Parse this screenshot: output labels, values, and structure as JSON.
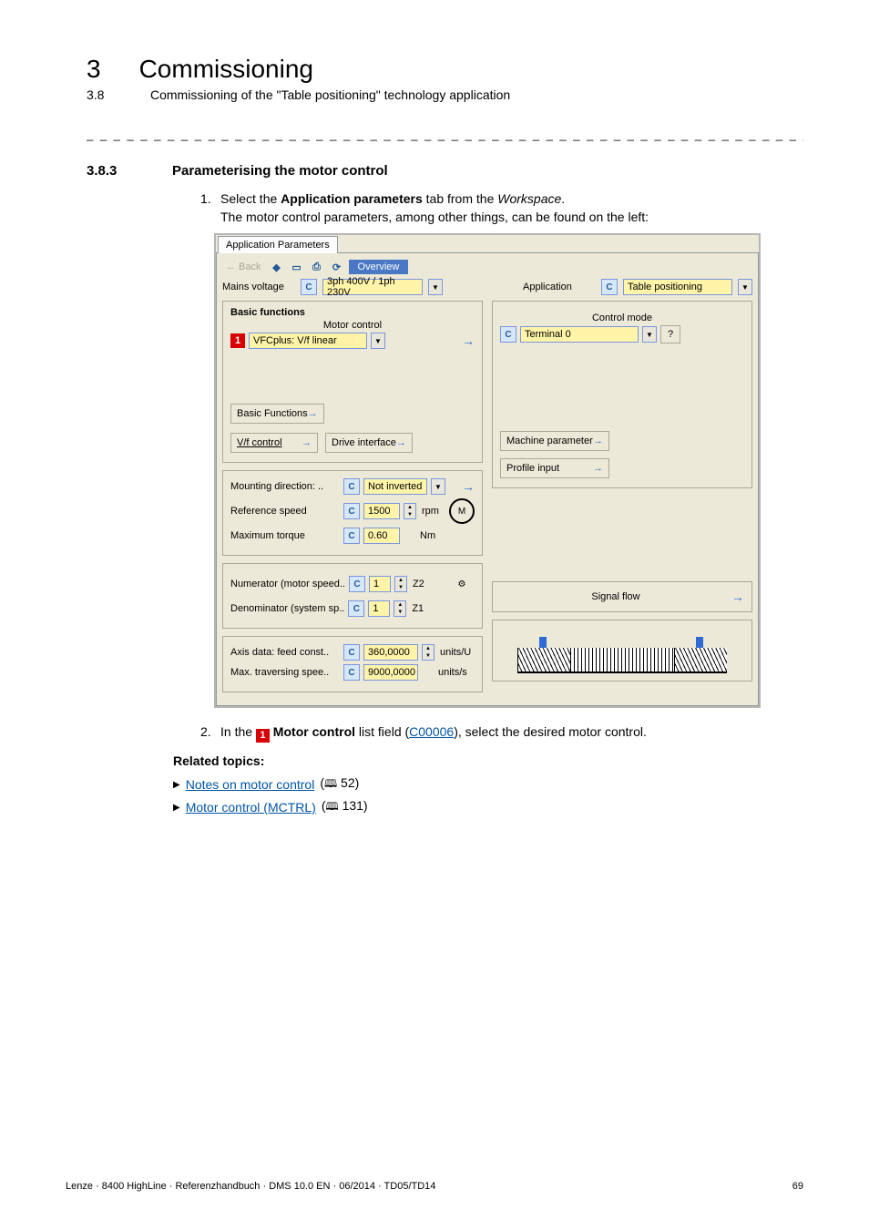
{
  "header": {
    "chapter_num": "3",
    "chapter_title": "Commissioning",
    "section_num": "3.8",
    "section_title": "Commissioning of the \"Table positioning\" technology application"
  },
  "sect": {
    "num": "3.8.3",
    "title": "Parameterising the motor control"
  },
  "step1": {
    "idx": "1.",
    "text_a": "Select the ",
    "text_b": "Application parameters",
    "text_c": " tab from the ",
    "text_d": "Workspace",
    "text_e": ".",
    "sub": "The motor control parameters, among other things, can be found on the left:"
  },
  "ap": {
    "tab": "Application Parameters",
    "back": "← Back",
    "overview": "Overview",
    "mains_voltage_lbl": "Mains voltage",
    "mains_voltage_val": "3ph 400V / 1ph 230V",
    "application_lbl": "Application",
    "application_val": "Table positioning",
    "basic_functions": "Basic functions",
    "motor_control_lbl": "Motor control",
    "motor_control_val": "VFCplus: V/f linear",
    "control_mode_lbl": "Control mode",
    "control_mode_val": "Terminal 0",
    "basic_functions_btn": "Basic Functions",
    "vf_control_btn": "V/f control",
    "drive_interface_btn": "Drive interface",
    "machine_param_btn": "Machine parameter",
    "profile_input_btn": "Profile input",
    "mounting_dir_lbl": "Mounting direction: ..",
    "mounting_dir_val": "Not inverted",
    "ref_speed_lbl": "Reference speed",
    "ref_speed_val": "1500",
    "ref_speed_unit": "rpm",
    "max_torque_lbl": "Maximum torque",
    "max_torque_val": "0.60",
    "max_torque_unit": "Nm",
    "num_lbl": "Numerator (motor speed..",
    "num_val": "1",
    "num_unit": "Z2",
    "den_lbl": "Denominator (system sp..",
    "den_val": "1",
    "den_unit": "Z1",
    "axis_lbl": "Axis data: feed const..",
    "axis_val": "360,0000",
    "axis_unit": "units/U",
    "max_trav_lbl": "Max. traversing spee..",
    "max_trav_val": "9000,0000",
    "max_trav_unit": "units/s",
    "signal_flow": "Signal flow",
    "c": "C",
    "one": "1",
    "q": "?"
  },
  "step2": {
    "idx": "2.",
    "a": "In the ",
    "b": "1",
    "c": " Motor control",
    "d": " list field (",
    "e": "C00006",
    "f": "), select the desired motor control."
  },
  "related": {
    "heading": "Related topics:",
    "r1_text": "Notes on motor control",
    "r1_page": "52)",
    "r2_text": "Motor control (MCTRL)",
    "r2_page": "131)"
  },
  "footer": {
    "left": "Lenze · 8400 HighLine · Referenzhandbuch · DMS 10.0 EN · 06/2014 · TD05/TD14",
    "right": "69"
  }
}
